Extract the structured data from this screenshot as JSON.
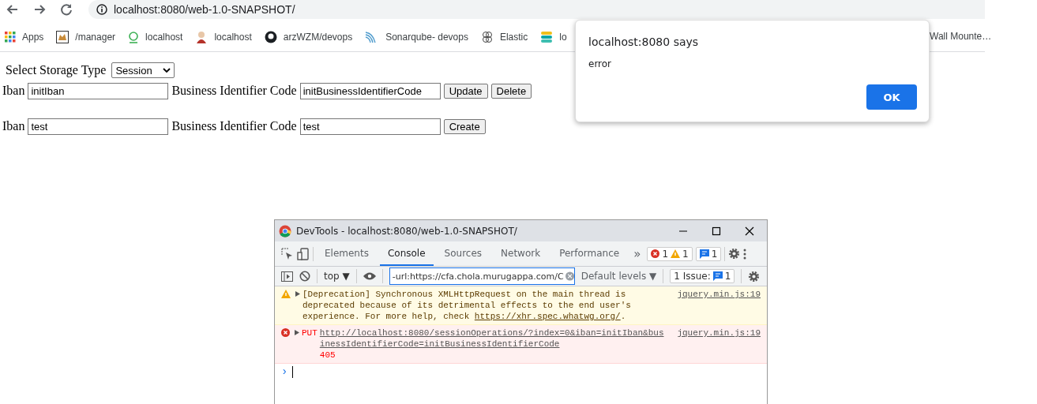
{
  "browser": {
    "address": "localhost:8080/web-1.0-SNAPSHOT/",
    "bookmarks": [
      {
        "label": "Apps"
      },
      {
        "label": "/manager"
      },
      {
        "label": "localhost"
      },
      {
        "label": "localhost"
      },
      {
        "label": "arzWZM/devops"
      },
      {
        "label": "Sonarqube- devops"
      },
      {
        "label": "Elastic"
      },
      {
        "label": "lo"
      }
    ],
    "bookmark_tail": "Wall Mounte…"
  },
  "page": {
    "storage_label": "Select Storage Type",
    "storage_value": "Session",
    "rows": [
      {
        "iban_label": "Iban",
        "iban": "initIban",
        "bic_label": "Business Identifier Code",
        "bic": "initBusinessIdentifierCode",
        "buttons": [
          "Update",
          "Delete"
        ]
      },
      {
        "iban_label": "Iban",
        "iban": "test",
        "bic_label": "Business Identifier Code",
        "bic": "test",
        "buttons": [
          "Create"
        ]
      }
    ]
  },
  "alert": {
    "title": "localhost:8080 says",
    "message": "error",
    "button": "OK"
  },
  "devtools": {
    "title": "DevTools - localhost:8080/web-1.0-SNAPSHOT/",
    "tabs": [
      {
        "label": "Elements",
        "selected": false
      },
      {
        "label": "Console",
        "selected": true
      },
      {
        "label": "Sources",
        "selected": false
      },
      {
        "label": "Network",
        "selected": false
      },
      {
        "label": "Performance",
        "selected": false
      }
    ],
    "more": "»",
    "error_count": "1",
    "warning_count": "1",
    "message_count": "1",
    "context": "top ▼",
    "filter": "-url:https://cfa.chola.murugappa.com/C",
    "levels": "Default levels ▼",
    "issues_label": "1 Issue:",
    "issues_count": "1",
    "messages": [
      {
        "kind": "warning",
        "text": "[Deprecation] Synchronous XMLHttpRequest on the main thread is deprecated because of its detrimental effects to the end user's experience. For more help, check ",
        "link": "https://xhr.spec.whatwg.org/",
        "tail": ".",
        "source": "jquery.min.js:19"
      },
      {
        "kind": "error",
        "method": "PUT",
        "link": "http://localhost:8080/sessionOperations/?index=0&iban=initIban&businessIdentifierCode=initBusinessIdentifierCode",
        "status": "405",
        "source": "jquery.min.js:19"
      }
    ],
    "prompt": "›"
  }
}
